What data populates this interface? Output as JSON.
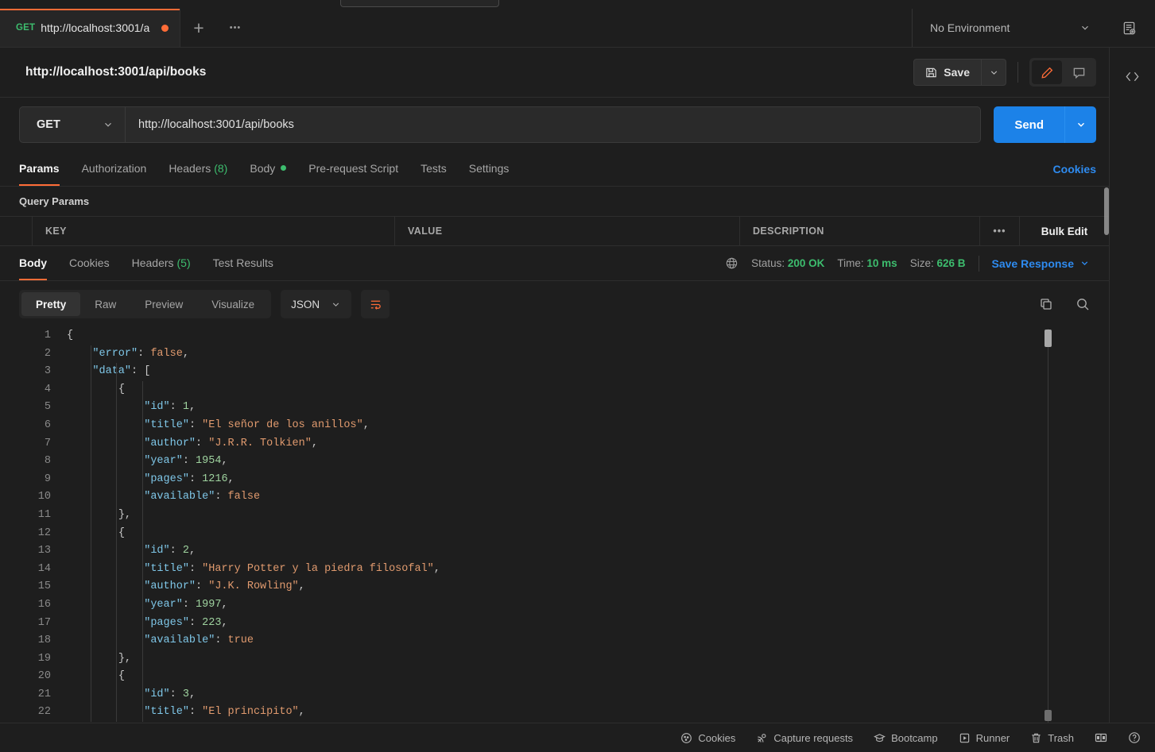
{
  "tabbar": {
    "tab": {
      "method": "GET",
      "name": "http://localhost:3001/a",
      "unsaved_dot": "•"
    },
    "new_tab_label": "+",
    "more_label": "•••",
    "environment": {
      "selected": "No Environment"
    }
  },
  "request_header": {
    "title": "http://localhost:3001/api/books",
    "save_label": "Save"
  },
  "url_bar": {
    "method": "GET",
    "url": "http://localhost:3001/api/books",
    "send_label": "Send"
  },
  "request_tabs": {
    "items": [
      {
        "label": "Params",
        "count": "",
        "dot": false,
        "active": true
      },
      {
        "label": "Authorization",
        "count": "",
        "dot": false,
        "active": false
      },
      {
        "label": "Headers",
        "count": "(8)",
        "dot": false,
        "active": false
      },
      {
        "label": "Body",
        "count": "",
        "dot": true,
        "active": false
      },
      {
        "label": "Pre-request Script",
        "count": "",
        "dot": false,
        "active": false
      },
      {
        "label": "Tests",
        "count": "",
        "dot": false,
        "active": false
      },
      {
        "label": "Settings",
        "count": "",
        "dot": false,
        "active": false
      }
    ],
    "cookies_link": "Cookies"
  },
  "query_params": {
    "title": "Query Params",
    "columns": [
      "KEY",
      "VALUE",
      "DESCRIPTION"
    ],
    "more_label": "•••",
    "bulk_edit_label": "Bulk Edit",
    "rows": []
  },
  "response": {
    "tabs": [
      {
        "label": "Body",
        "count": "",
        "active": true
      },
      {
        "label": "Cookies",
        "count": "",
        "active": false
      },
      {
        "label": "Headers",
        "count": "(5)",
        "active": false
      },
      {
        "label": "Test Results",
        "count": "",
        "active": false
      }
    ],
    "status_label": "Status:",
    "status_value": "200 OK",
    "time_label": "Time:",
    "time_value": "10 ms",
    "size_label": "Size:",
    "size_value": "626 B",
    "save_response_label": "Save Response",
    "view_modes": [
      {
        "label": "Pretty",
        "active": true
      },
      {
        "label": "Raw",
        "active": false
      },
      {
        "label": "Preview",
        "active": false
      },
      {
        "label": "Visualize",
        "active": false
      }
    ],
    "format": "JSON"
  },
  "code": {
    "lines": [
      {
        "n": "1",
        "indent": 0,
        "tokens": [
          {
            "t": "{",
            "c": "p"
          }
        ]
      },
      {
        "n": "2",
        "indent": 1,
        "tokens": [
          {
            "t": "\"error\"",
            "c": "k"
          },
          {
            "t": ": ",
            "c": "p"
          },
          {
            "t": "false",
            "c": "b"
          },
          {
            "t": ",",
            "c": "p"
          }
        ]
      },
      {
        "n": "3",
        "indent": 1,
        "tokens": [
          {
            "t": "\"data\"",
            "c": "k"
          },
          {
            "t": ": [",
            "c": "p"
          }
        ]
      },
      {
        "n": "4",
        "indent": 2,
        "tokens": [
          {
            "t": "{",
            "c": "p"
          }
        ]
      },
      {
        "n": "5",
        "indent": 3,
        "tokens": [
          {
            "t": "\"id\"",
            "c": "k"
          },
          {
            "t": ": ",
            "c": "p"
          },
          {
            "t": "1",
            "c": "n"
          },
          {
            "t": ",",
            "c": "p"
          }
        ]
      },
      {
        "n": "6",
        "indent": 3,
        "tokens": [
          {
            "t": "\"title\"",
            "c": "k"
          },
          {
            "t": ": ",
            "c": "p"
          },
          {
            "t": "\"El señor de los anillos\"",
            "c": "s"
          },
          {
            "t": ",",
            "c": "p"
          }
        ]
      },
      {
        "n": "7",
        "indent": 3,
        "tokens": [
          {
            "t": "\"author\"",
            "c": "k"
          },
          {
            "t": ": ",
            "c": "p"
          },
          {
            "t": "\"J.R.R. Tolkien\"",
            "c": "s"
          },
          {
            "t": ",",
            "c": "p"
          }
        ]
      },
      {
        "n": "8",
        "indent": 3,
        "tokens": [
          {
            "t": "\"year\"",
            "c": "k"
          },
          {
            "t": ": ",
            "c": "p"
          },
          {
            "t": "1954",
            "c": "n"
          },
          {
            "t": ",",
            "c": "p"
          }
        ]
      },
      {
        "n": "9",
        "indent": 3,
        "tokens": [
          {
            "t": "\"pages\"",
            "c": "k"
          },
          {
            "t": ": ",
            "c": "p"
          },
          {
            "t": "1216",
            "c": "n"
          },
          {
            "t": ",",
            "c": "p"
          }
        ]
      },
      {
        "n": "10",
        "indent": 3,
        "tokens": [
          {
            "t": "\"available\"",
            "c": "k"
          },
          {
            "t": ": ",
            "c": "p"
          },
          {
            "t": "false",
            "c": "b"
          }
        ]
      },
      {
        "n": "11",
        "indent": 2,
        "tokens": [
          {
            "t": "},",
            "c": "p"
          }
        ]
      },
      {
        "n": "12",
        "indent": 2,
        "tokens": [
          {
            "t": "{",
            "c": "p"
          }
        ]
      },
      {
        "n": "13",
        "indent": 3,
        "tokens": [
          {
            "t": "\"id\"",
            "c": "k"
          },
          {
            "t": ": ",
            "c": "p"
          },
          {
            "t": "2",
            "c": "n"
          },
          {
            "t": ",",
            "c": "p"
          }
        ]
      },
      {
        "n": "14",
        "indent": 3,
        "tokens": [
          {
            "t": "\"title\"",
            "c": "k"
          },
          {
            "t": ": ",
            "c": "p"
          },
          {
            "t": "\"Harry Potter y la piedra filosofal\"",
            "c": "s"
          },
          {
            "t": ",",
            "c": "p"
          }
        ]
      },
      {
        "n": "15",
        "indent": 3,
        "tokens": [
          {
            "t": "\"author\"",
            "c": "k"
          },
          {
            "t": ": ",
            "c": "p"
          },
          {
            "t": "\"J.K. Rowling\"",
            "c": "s"
          },
          {
            "t": ",",
            "c": "p"
          }
        ]
      },
      {
        "n": "16",
        "indent": 3,
        "tokens": [
          {
            "t": "\"year\"",
            "c": "k"
          },
          {
            "t": ": ",
            "c": "p"
          },
          {
            "t": "1997",
            "c": "n"
          },
          {
            "t": ",",
            "c": "p"
          }
        ]
      },
      {
        "n": "17",
        "indent": 3,
        "tokens": [
          {
            "t": "\"pages\"",
            "c": "k"
          },
          {
            "t": ": ",
            "c": "p"
          },
          {
            "t": "223",
            "c": "n"
          },
          {
            "t": ",",
            "c": "p"
          }
        ]
      },
      {
        "n": "18",
        "indent": 3,
        "tokens": [
          {
            "t": "\"available\"",
            "c": "k"
          },
          {
            "t": ": ",
            "c": "p"
          },
          {
            "t": "true",
            "c": "b"
          }
        ]
      },
      {
        "n": "19",
        "indent": 2,
        "tokens": [
          {
            "t": "},",
            "c": "p"
          }
        ]
      },
      {
        "n": "20",
        "indent": 2,
        "tokens": [
          {
            "t": "{",
            "c": "p"
          }
        ]
      },
      {
        "n": "21",
        "indent": 3,
        "tokens": [
          {
            "t": "\"id\"",
            "c": "k"
          },
          {
            "t": ": ",
            "c": "p"
          },
          {
            "t": "3",
            "c": "n"
          },
          {
            "t": ",",
            "c": "p"
          }
        ]
      },
      {
        "n": "22",
        "indent": 3,
        "tokens": [
          {
            "t": "\"title\"",
            "c": "k"
          },
          {
            "t": ": ",
            "c": "p"
          },
          {
            "t": "\"El principito\"",
            "c": "s"
          },
          {
            "t": ",",
            "c": "p"
          }
        ]
      }
    ]
  },
  "bottom_bar": {
    "items": [
      {
        "label": "Cookies",
        "icon": "cookie-icon"
      },
      {
        "label": "Capture requests",
        "icon": "satellite-icon"
      },
      {
        "label": "Bootcamp",
        "icon": "graduation-cap-icon"
      },
      {
        "label": "Runner",
        "icon": "play-box-icon"
      },
      {
        "label": "Trash",
        "icon": "trash-icon"
      }
    ]
  },
  "colors": {
    "accent_orange": "#ff6c37",
    "send_blue": "#1c82e8",
    "link_blue": "#2e8bf0",
    "status_green": "#3dbd6e",
    "bg": "#1e1e1e",
    "panel": "#262626"
  }
}
